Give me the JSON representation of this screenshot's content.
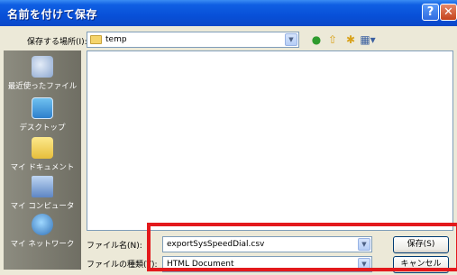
{
  "window": {
    "title": "名前を付けて保存",
    "help_glyph": "?",
    "close_glyph": "✕"
  },
  "toolbar": {
    "save_in_label": "保存する場所(I):",
    "save_in_value": "temp",
    "back_icon": "back-icon",
    "up_icon": "up-folder-icon",
    "new_folder_icon": "new-folder-icon",
    "views_icon": "views-menu-icon"
  },
  "places": [
    {
      "label": "最近使ったファイル",
      "icon": "recent-documents-icon"
    },
    {
      "label": "デスクトップ",
      "icon": "desktop-icon"
    },
    {
      "label": "マイ ドキュメント",
      "icon": "my-documents-icon"
    },
    {
      "label": "マイ コンピュータ",
      "icon": "my-computer-icon"
    },
    {
      "label": "マイ ネットワーク",
      "icon": "my-network-icon"
    }
  ],
  "form": {
    "filename_label": "ファイル名(N):",
    "filename_value": "exportSysSpeedDial.csv",
    "filetype_label": "ファイルの種類(T):",
    "filetype_value": "HTML Document",
    "save_button": "保存(S)",
    "cancel_button": "キャンセル"
  },
  "colors": {
    "titlebar": "#0850D8",
    "highlight": "#E3191C",
    "dialog_bg": "#ECE9D8"
  }
}
